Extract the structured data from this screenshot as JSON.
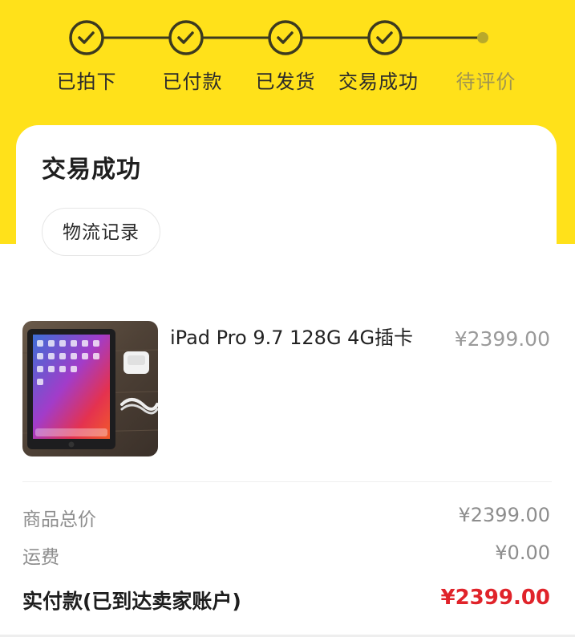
{
  "progress": {
    "steps": [
      {
        "label": "已拍下",
        "done": true
      },
      {
        "label": "已付款",
        "done": true
      },
      {
        "label": "已发货",
        "done": true
      },
      {
        "label": "交易成功",
        "done": true
      },
      {
        "label": "待评价",
        "done": false
      }
    ],
    "icon_done": "check-circle-icon",
    "icon_pending": "dot-icon"
  },
  "status_card": {
    "title": "交易成功",
    "logistics_button": "物流记录"
  },
  "product": {
    "title": "iPad Pro 9.7 128G 4G插卡",
    "price": "¥2399.00"
  },
  "summary": {
    "goods_total_label": "商品总价",
    "goods_total_value": "¥2399.00",
    "shipping_label": "运费",
    "shipping_value": "¥0.00",
    "paid_label": "实付款(已到达卖家账户)",
    "paid_value": "¥2399.00"
  },
  "colors": {
    "header_yellow": "#ffe11a",
    "paid_red": "#e0232a",
    "muted_gray": "#8d8d8d"
  }
}
